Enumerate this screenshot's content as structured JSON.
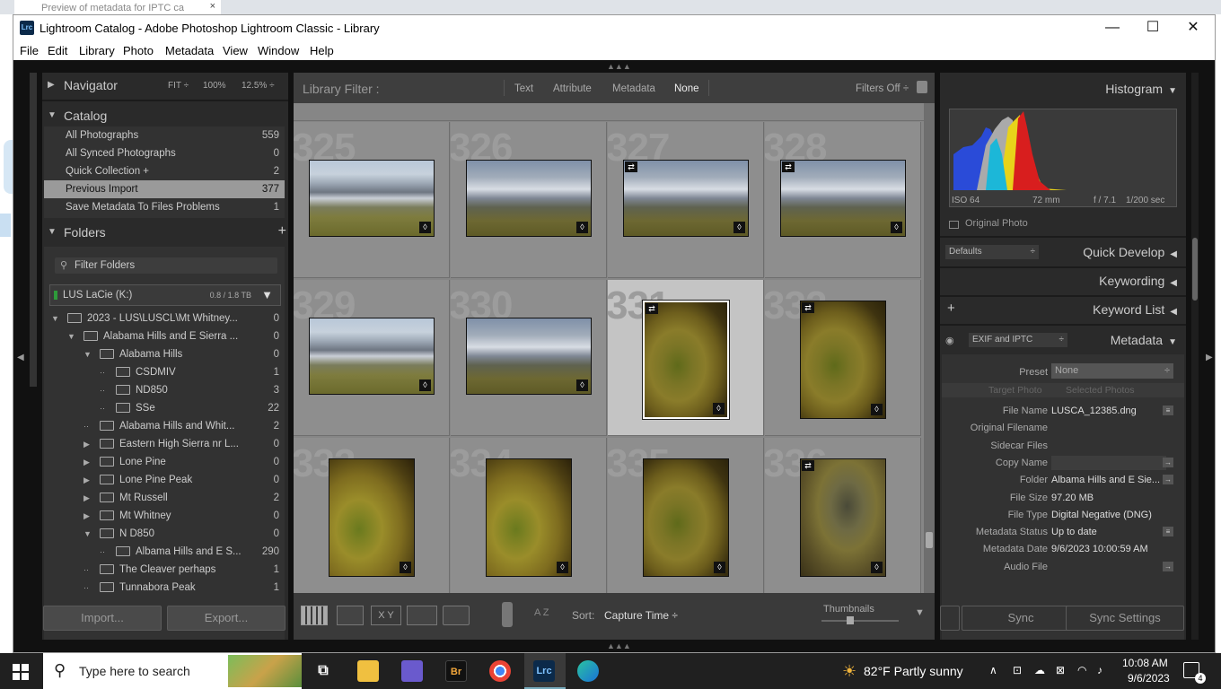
{
  "browser_tab": {
    "title": "Preview of metadata for IPTC ca",
    "close": "×"
  },
  "window": {
    "title": "Lightroom Catalog - Adobe Photoshop Lightroom Classic - Library",
    "app_icon": "Lrc",
    "minimize": "—",
    "maximize": "☐",
    "close": "✕"
  },
  "menu": [
    "File",
    "Edit",
    "Library",
    "Photo",
    "Metadata",
    "View",
    "Window",
    "Help"
  ],
  "navigator": {
    "label": "Navigator",
    "fit": "FIT ÷",
    "zoom1": "100%",
    "zoom2": "12.5% ÷"
  },
  "catalog": {
    "label": "Catalog",
    "items": [
      {
        "label": "All Photographs",
        "count": "559"
      },
      {
        "label": "All Synced Photographs",
        "count": "0"
      },
      {
        "label": "Quick Collection +",
        "count": "2"
      },
      {
        "label": "Previous Import",
        "count": "377"
      },
      {
        "label": "Save Metadata To Files Problems",
        "count": "1"
      }
    ]
  },
  "folders": {
    "label": "Folders",
    "add": "+",
    "filter_label": "Filter Folders",
    "volume": {
      "name": "LUS LaCie (K:)",
      "size": "0.8 / 1.8 TB"
    },
    "items": [
      {
        "label": "2023 - LUS\\LUSCL\\Mt Whitney...",
        "count": "0"
      },
      {
        "label": "Alabama Hills and E Sierra ...",
        "count": "0"
      },
      {
        "label": "Alabama Hills",
        "count": "0"
      },
      {
        "label": "CSDMIV",
        "count": "1"
      },
      {
        "label": "ND850",
        "count": "3"
      },
      {
        "label": "SSe",
        "count": "22"
      },
      {
        "label": "Alabama Hills and Whit...",
        "count": "2"
      },
      {
        "label": "Eastern High Sierra nr L...",
        "count": "0"
      },
      {
        "label": "Lone Pine",
        "count": "0"
      },
      {
        "label": "Lone Pine Peak",
        "count": "0"
      },
      {
        "label": "Mt Russell",
        "count": "2"
      },
      {
        "label": "Mt Whitney",
        "count": "0"
      },
      {
        "label": "N D850",
        "count": "0"
      },
      {
        "label": "Albama Hills and E S...",
        "count": "290"
      },
      {
        "label": "The Cleaver perhaps",
        "count": "1"
      },
      {
        "label": "Tunnabora Peak",
        "count": "1"
      }
    ]
  },
  "import_btn": "Import...",
  "export_btn": "Export...",
  "library_filter": {
    "label": "Library Filter :",
    "tabs": [
      "Text",
      "Attribute",
      "Metadata",
      "None"
    ],
    "filters_off": "Filters Off ÷"
  },
  "grid": {
    "cells": [
      {
        "num": "325",
        "style": "mtn",
        "badge": "◊",
        "edited": false
      },
      {
        "num": "326",
        "style": "mtn2",
        "badge": "◊",
        "edited": false
      },
      {
        "num": "327",
        "style": "mtn2",
        "badge": "◊",
        "edited": true
      },
      {
        "num": "328",
        "style": "mtn2",
        "badge": "◊",
        "edited": true
      },
      {
        "num": "329",
        "style": "mtn",
        "badge": "◊",
        "edited": false
      },
      {
        "num": "330",
        "style": "mtn2",
        "badge": "◊",
        "edited": false
      },
      {
        "num": "331",
        "style": "rock",
        "badge": "◊",
        "edited": true,
        "selected": true
      },
      {
        "num": "332",
        "style": "rock",
        "badge": "◊",
        "edited": true
      },
      {
        "num": "333",
        "style": "rock2",
        "badge": "◊",
        "edited": false
      },
      {
        "num": "334",
        "style": "rock2",
        "badge": "◊",
        "edited": false
      },
      {
        "num": "335",
        "style": "rock",
        "badge": "◊",
        "edited": false
      },
      {
        "num": "336",
        "style": "rock3",
        "badge": "◊",
        "edited": true
      }
    ]
  },
  "toolbar": {
    "sort_label": "Sort:",
    "sort_value": "Capture Time ÷",
    "thumbnails": "Thumbnails",
    "az": "A Z",
    "xy": "X Y"
  },
  "histogram": {
    "label": "Histogram",
    "iso": "ISO 64",
    "focal": "72 mm",
    "aperture": "f / 7.1",
    "shutter": "1/200 sec",
    "original_photo": "Original Photo"
  },
  "quick_develop": {
    "label": "Quick Develop",
    "preset": "Defaults"
  },
  "keywording": {
    "label": "Keywording"
  },
  "keyword_list": {
    "label": "Keyword List",
    "add": "+"
  },
  "metadata": {
    "label": "Metadata",
    "view": "EXIF and IPTC",
    "preset_label": "Preset",
    "preset_value": "None",
    "target": "Target Photo",
    "selected": "Selected Photos",
    "rows": [
      {
        "k": "File Name",
        "v": "LUSCA_12385.dng",
        "icon": "≡"
      },
      {
        "k": "Original Filename",
        "v": "",
        "icon": ""
      },
      {
        "k": "Sidecar Files",
        "v": "",
        "icon": ""
      },
      {
        "k": "Copy Name",
        "v": "",
        "icon": "→"
      },
      {
        "k": "Folder",
        "v": "Albama Hills and E Sie...",
        "icon": "→"
      },
      {
        "k": "File Size",
        "v": "97.20 MB",
        "icon": ""
      },
      {
        "k": "File Type",
        "v": "Digital Negative (DNG)",
        "icon": ""
      },
      {
        "k": "Metadata Status",
        "v": "Up to date",
        "icon": "≡"
      },
      {
        "k": "Metadata Date",
        "v": "9/6/2023 10:00:59 AM",
        "icon": ""
      },
      {
        "k": "Audio File",
        "v": "",
        "icon": "→"
      }
    ]
  },
  "sync_btn": "Sync",
  "sync_settings_btn": "Sync Settings",
  "taskbar": {
    "search_placeholder": "Type here to search",
    "weather": "82°F  Partly sunny",
    "time": "10:08 AM",
    "date": "9/6/2023",
    "notifications": "4",
    "apps": [
      "Br",
      "Lrc"
    ]
  }
}
